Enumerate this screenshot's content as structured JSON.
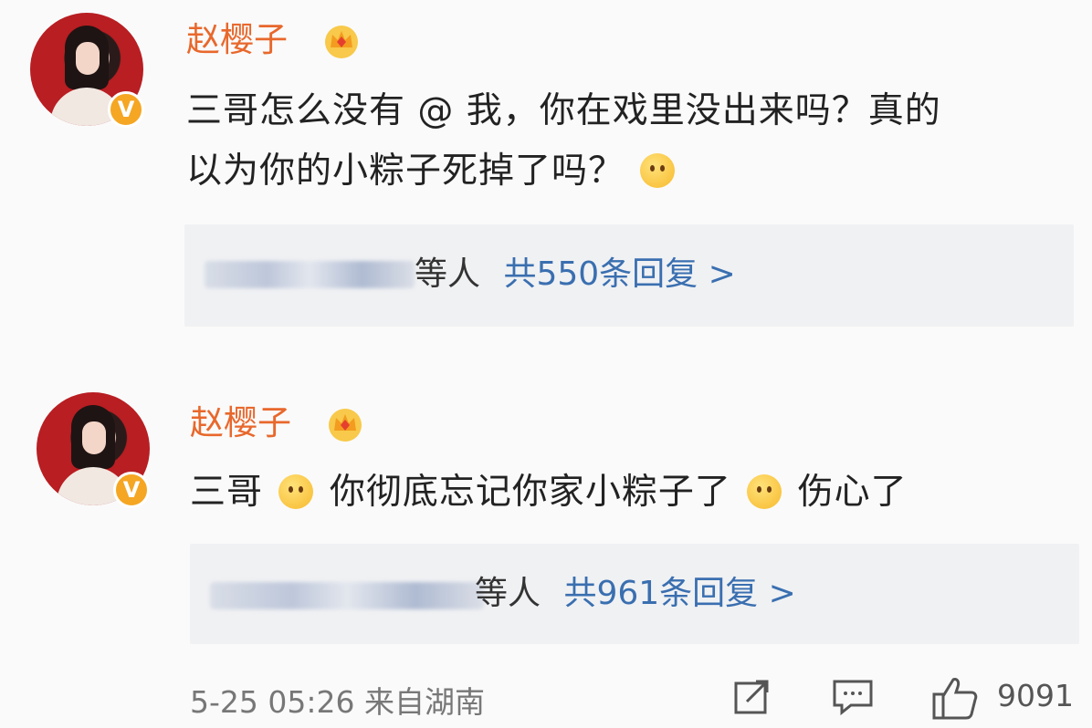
{
  "comments": [
    {
      "username": "赵樱子",
      "text_line1": "三哥怎么没有 @ 我，你在戏里没出来吗？真的",
      "text_line2": "以为你的小粽子死掉了吗？",
      "emoji": "sad-face-icon",
      "reply_who": "等人",
      "reply_count": "共550条回复 >"
    },
    {
      "username": "赵樱子",
      "text_part1": "三哥",
      "text_part2": "你彻底忘记你家小粽子了",
      "text_part3": "伤心了",
      "emoji1": "smile-face-icon",
      "emoji2": "sad-face-icon",
      "reply_who": "等人",
      "reply_count": "共961条回复 >"
    }
  ],
  "footer": {
    "time": "5-25 05:26 来自湖南",
    "likes": "9091",
    "icons": [
      "share-icon",
      "comment-icon",
      "like-icon"
    ]
  },
  "colors": {
    "username": "#e8682c",
    "link": "#3a6fb0",
    "badge": "#f5a623"
  }
}
